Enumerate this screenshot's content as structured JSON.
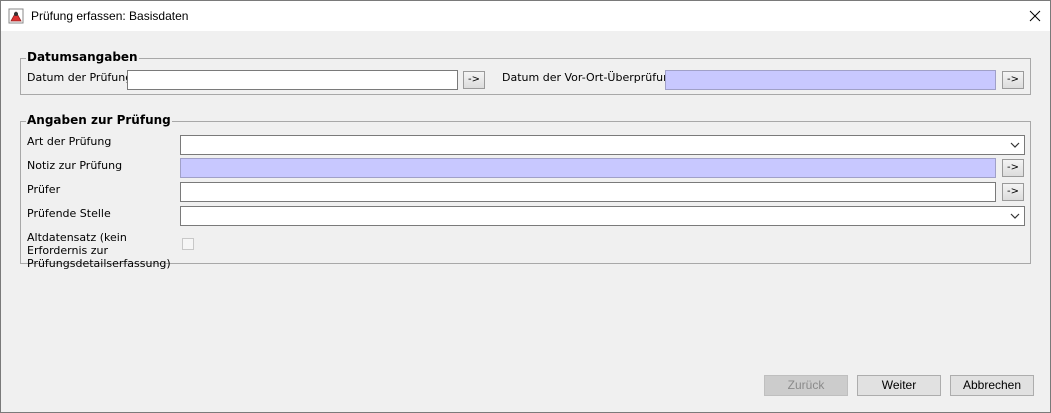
{
  "window": {
    "title": "Prüfung erfassen: Basisdaten",
    "app_icon": "java-app-icon",
    "close_icon": "close-icon"
  },
  "dates_group": {
    "title": "Datumsangaben",
    "pruefung_label": "Datum der Prüfung",
    "pruefung_value": "",
    "pruefung_button": "->",
    "vor_ort_label": "Datum der Vor-Ort-Überprüfung",
    "vor_ort_value": "",
    "vor_ort_button": "->"
  },
  "details_group": {
    "title": "Angaben zur Prüfung",
    "art_label": "Art der Prüfung",
    "art_value": "",
    "notiz_label": "Notiz zur Prüfung",
    "notiz_value": "",
    "notiz_button": "->",
    "pruefer_label": "Prüfer",
    "pruefer_value": "",
    "pruefer_button": "->",
    "stelle_label": "Prüfende Stelle",
    "stelle_value": "",
    "altdaten_label": "Altdatensatz (kein Erfordernis zur Prüfungsdetailserfassung)",
    "altdaten_checked": false
  },
  "footer": {
    "back_label": "Zurück",
    "next_label": "Weiter",
    "cancel_label": "Abbrechen"
  },
  "colors": {
    "readonly_field": "#c8c8ff",
    "window_bg": "#f0f0f0",
    "titlebar_bg": "#ffffff"
  }
}
